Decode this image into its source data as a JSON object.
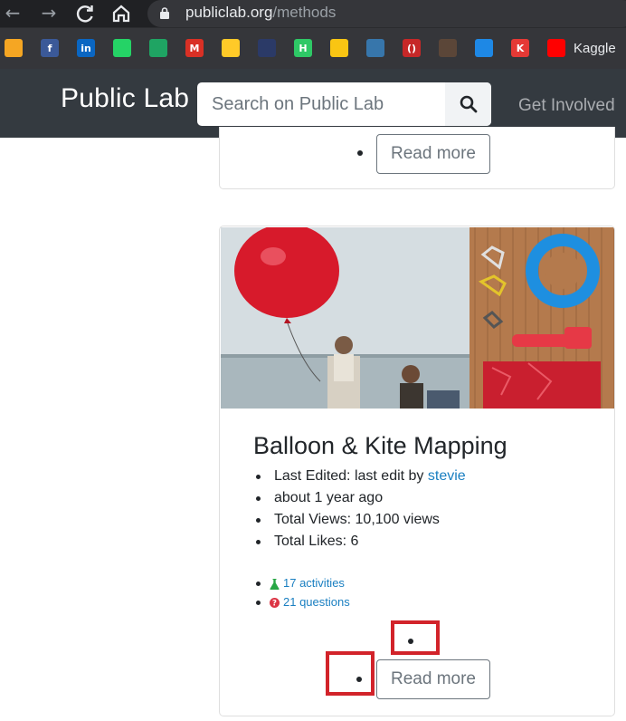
{
  "browser": {
    "url_domain": "publiclab.org",
    "url_path": "/methods",
    "bookmarks": [
      {
        "icon": "hourglass-icon",
        "color": "#f5a623"
      },
      {
        "icon": "facebook-icon",
        "color": "#3b5998",
        "glyph": "f"
      },
      {
        "icon": "linkedin-icon",
        "color": "#0a66c2",
        "glyph": "in"
      },
      {
        "icon": "whatsapp-icon",
        "color": "#25d366"
      },
      {
        "icon": "google-drive-icon",
        "color": "#1fa463"
      },
      {
        "icon": "gmail-icon",
        "color": "#d93025",
        "glyph": "M"
      },
      {
        "icon": "firebase-icon",
        "color": "#ffca28"
      },
      {
        "icon": "dark-square-icon",
        "color": "#2b3a67"
      },
      {
        "icon": "hackerrank-icon",
        "color": "#2ec866",
        "glyph": "H"
      },
      {
        "icon": "lightbulb-icon",
        "color": "#f9c513"
      },
      {
        "icon": "python-icon",
        "color": "#3776ab"
      },
      {
        "icon": "brackets-icon",
        "color": "#c62828",
        "glyph": "()"
      },
      {
        "icon": "codechef-icon",
        "color": "#5b4638"
      },
      {
        "icon": "sync-icon",
        "color": "#1e88e5"
      },
      {
        "icon": "k-icon",
        "color": "#e53935",
        "glyph": "K"
      },
      {
        "icon": "youtube-icon",
        "color": "#ff0000"
      }
    ],
    "bookmark_last_label": "Kaggle"
  },
  "navbar": {
    "brand": "Public Lab",
    "search_placeholder": "Search on Public Lab",
    "get_involved": "Get Involved"
  },
  "previous_card": {
    "read_more": "Read more"
  },
  "card": {
    "title": "Balloon & Kite Mapping",
    "last_edited_label": "Last Edited: last edit by ",
    "last_edited_user": "stevie",
    "time_ago": "about 1 year ago",
    "total_views": "Total Views: 10,100 views",
    "total_likes": "Total Likes: 6",
    "activities": "17 activities",
    "questions": "21 questions",
    "read_more": "Read more"
  },
  "colors": {
    "navbar_bg": "#343a40",
    "link": "#1a7fc1",
    "highlight": "#d2232a",
    "question_icon": "#dc3545",
    "activity_icon": "#28a745"
  }
}
